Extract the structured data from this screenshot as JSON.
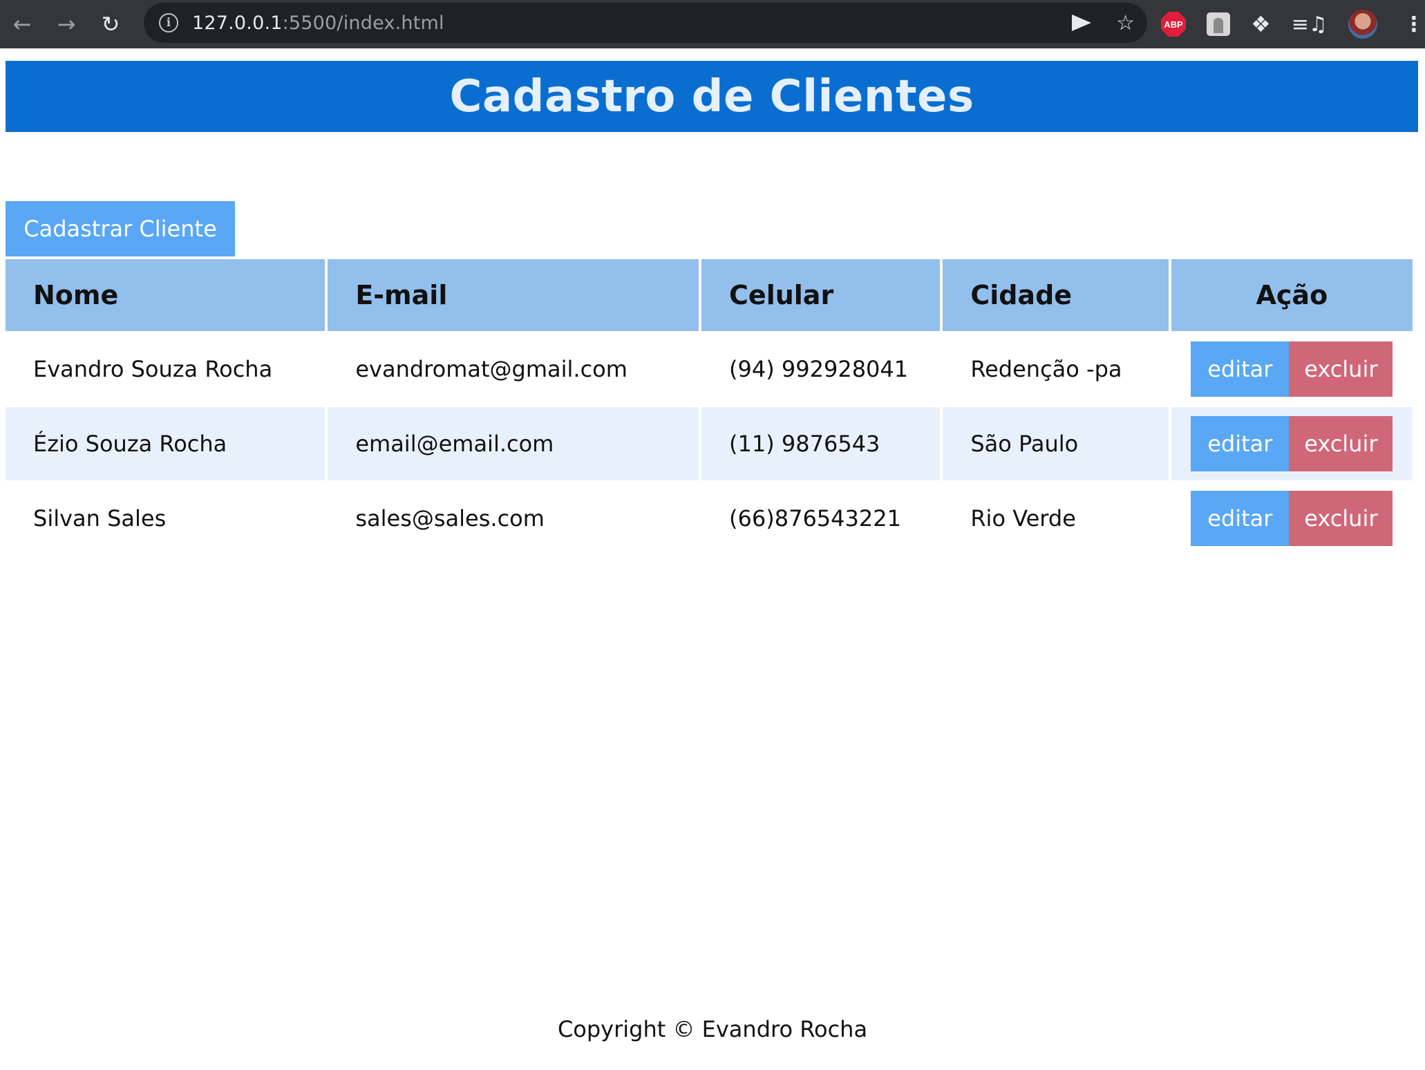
{
  "browser": {
    "url_host": "127.0.0.1",
    "url_rest": ":5500/index.html",
    "abp_label": "ABP",
    "icons": [
      "back-arrow-icon",
      "forward-arrow-icon",
      "reload-icon",
      "info-icon",
      "send-icon",
      "star-icon",
      "adblock-icon",
      "extension-icon",
      "puzzle-icon",
      "media-icon",
      "profile-avatar",
      "menu-icon"
    ]
  },
  "header": {
    "title": "Cadastro de Clientes"
  },
  "toolbar": {
    "add_label": "Cadastrar Cliente"
  },
  "table": {
    "columns": [
      "Nome",
      "E-mail",
      "Celular",
      "Cidade",
      "Ação"
    ],
    "rows": [
      {
        "nome": "Evandro Souza Rocha",
        "email": "evandromat@gmail.com",
        "celular": "(94) 992928041",
        "cidade": "Redenção -pa",
        "edit": "editar",
        "delete": "excluir"
      },
      {
        "nome": "Ézio Souza Rocha",
        "email": "email@email.com",
        "celular": "(11) 9876543",
        "cidade": "São Paulo",
        "edit": "editar",
        "delete": "excluir"
      },
      {
        "nome": "Silvan Sales",
        "email": "sales@sales.com",
        "celular": "(66)876543221",
        "cidade": "Rio Verde",
        "edit": "editar",
        "delete": "excluir"
      }
    ]
  },
  "footer": {
    "text": "Copyright © Evandro Rocha"
  },
  "colors": {
    "header_bg": "#0a6ed1",
    "primary_button": "#59a7f5",
    "danger_button": "#cf6778",
    "table_header_bg": "#92bfec",
    "alt_row_bg": "#e8f1fb"
  }
}
